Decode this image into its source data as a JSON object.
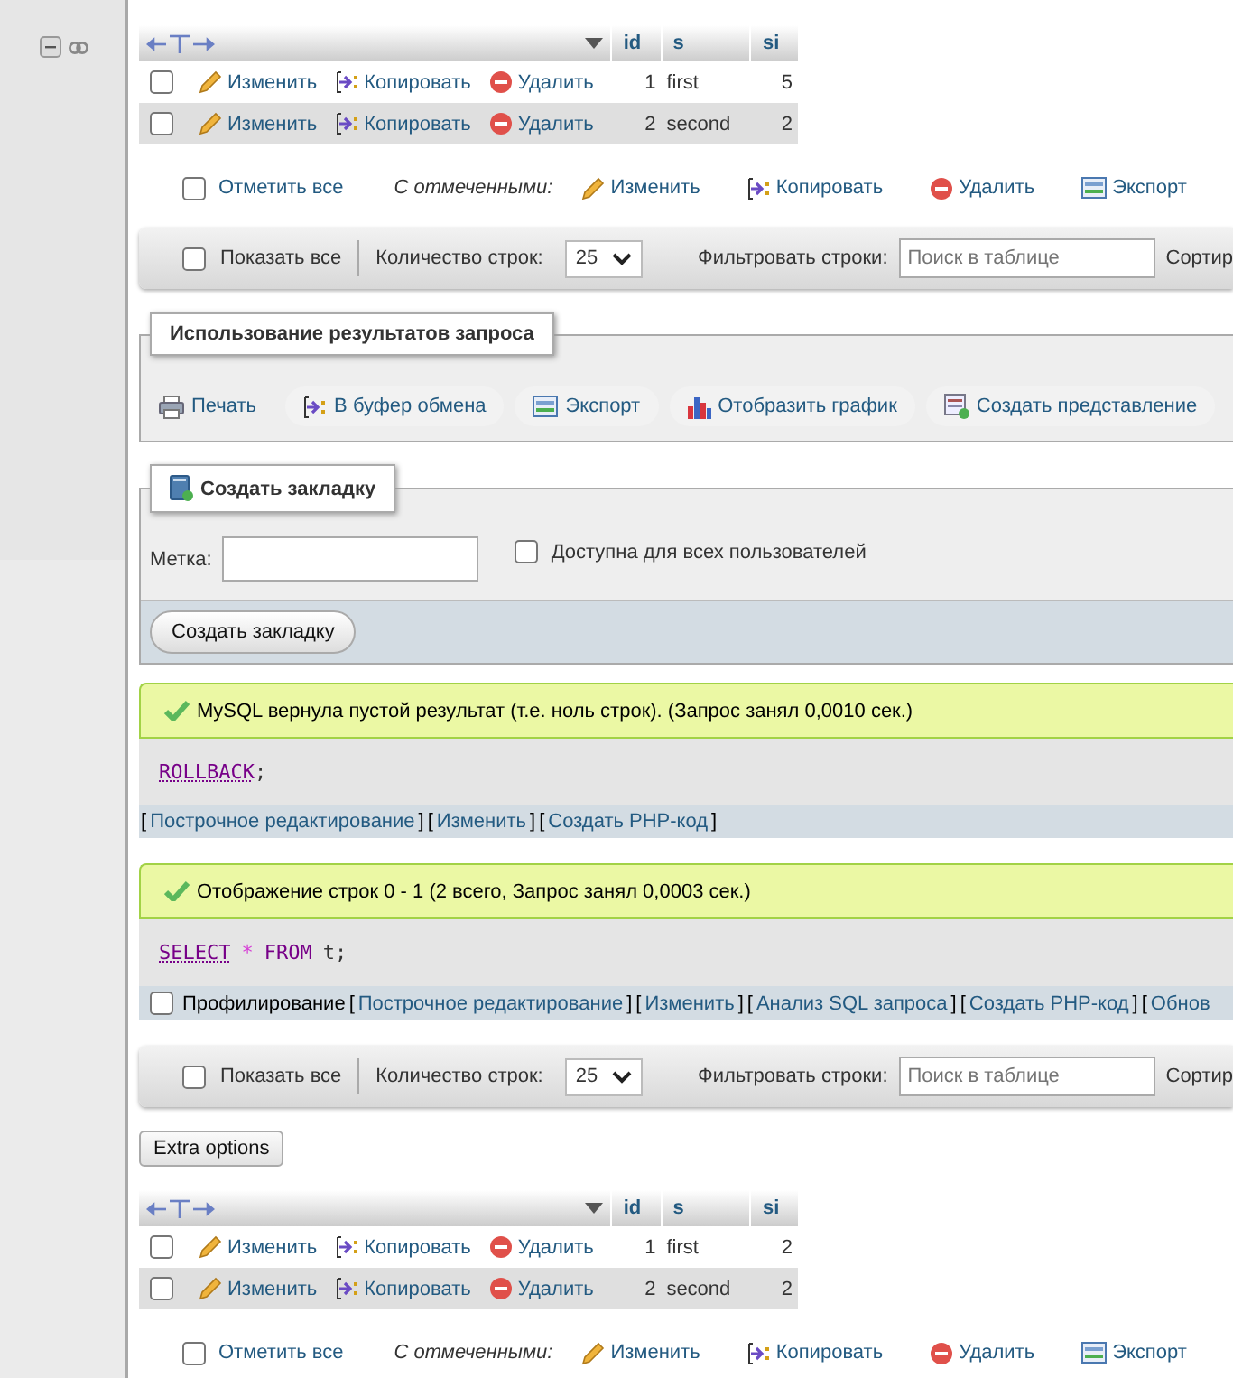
{
  "blocks": [
    {
      "kind": "table",
      "columns": [
        "id",
        "s",
        "si"
      ],
      "rows": [
        {
          "checked": false,
          "actions": [
            "Изменить",
            "Копировать",
            "Удалить"
          ],
          "cells": [
            "1",
            "first",
            "5"
          ]
        },
        {
          "checked": false,
          "actions": [
            "Изменить",
            "Копировать",
            "Удалить"
          ],
          "cells": [
            "2",
            "second",
            "2"
          ]
        }
      ]
    },
    {
      "kind": "bulk",
      "check_all": {
        "label": "Отметить все",
        "checked": false
      },
      "with_selected": "С отмеченными:",
      "actions": [
        "Изменить",
        "Копировать",
        "Удалить",
        "Экспорт"
      ]
    },
    {
      "kind": "nav",
      "show_all": {
        "label": "Показать все",
        "checked": false
      },
      "rows_label": "Количество строк:",
      "rows_value": "25",
      "filter_label": "Фильтровать строки:",
      "filter_placeholder": "Поиск в таблице",
      "sort_label": "Сортир"
    },
    {
      "kind": "operations",
      "legend": "Использование результатов запроса",
      "buttons": [
        "Печать",
        "В буфер обмена",
        "Экспорт",
        "Отобразить график",
        "Создать представление"
      ]
    },
    {
      "kind": "bookmark",
      "legend": "Создать закладку",
      "label_field": "Метка:",
      "public": {
        "label": "Доступна для всех пользователей",
        "checked": false
      },
      "submit": "Создать закладку"
    },
    {
      "kind": "message",
      "text": "MySQL вернула пустой результат (т.е. ноль строк). (Запрос занял 0,0010 сек.)",
      "sql": [
        {
          "kind": "keyword",
          "text": "ROLLBACK"
        },
        {
          "kind": "plain",
          "text": ";"
        }
      ],
      "parts": [
        {
          "kind": "bracket",
          "text": "["
        },
        {
          "kind": "link",
          "text": "Построчное редактирование"
        },
        {
          "kind": "bracket",
          "text": "]"
        },
        {
          "kind": "bracket",
          "text": "["
        },
        {
          "kind": "link",
          "text": "Изменить"
        },
        {
          "kind": "bracket",
          "text": "]"
        },
        {
          "kind": "bracket",
          "text": "["
        },
        {
          "kind": "link",
          "text": "Создать PHP-код"
        },
        {
          "kind": "bracket",
          "text": "]"
        }
      ]
    },
    {
      "kind": "message",
      "text": "Отображение строк 0 - 1 (2 всего, Запрос занял 0,0003 сек.)",
      "sql": [
        {
          "kind": "keyword",
          "text": "SELECT"
        },
        {
          "kind": "operator",
          "text": "*"
        },
        {
          "kind": "keyword",
          "text": "FROM"
        },
        {
          "kind": "plain",
          "text": "t;"
        }
      ],
      "profiling": {
        "label": "Профилирование",
        "checked": false
      },
      "parts": [
        {
          "kind": "bracket",
          "text": "["
        },
        {
          "kind": "link",
          "text": "Построчное редактирование"
        },
        {
          "kind": "bracket",
          "text": "]"
        },
        {
          "kind": "bracket",
          "text": "["
        },
        {
          "kind": "link",
          "text": "Изменить"
        },
        {
          "kind": "bracket",
          "text": "]"
        },
        {
          "kind": "bracket",
          "text": "["
        },
        {
          "kind": "link",
          "text": "Анализ SQL запроса"
        },
        {
          "kind": "bracket",
          "text": "]"
        },
        {
          "kind": "bracket",
          "text": "["
        },
        {
          "kind": "link",
          "text": "Создать PHP-код"
        },
        {
          "kind": "bracket",
          "text": "]"
        },
        {
          "kind": "bracket",
          "text": "["
        },
        {
          "kind": "link",
          "text": "Обнов"
        }
      ]
    },
    {
      "kind": "nav",
      "show_all": {
        "label": "Показать все",
        "checked": false
      },
      "rows_label": "Количество строк:",
      "rows_value": "25",
      "filter_label": "Фильтровать строки:",
      "filter_placeholder": "Поиск в таблице",
      "sort_label": "Сортир"
    },
    {
      "kind": "button",
      "label": "Extra options"
    },
    {
      "kind": "table",
      "columns": [
        "id",
        "s",
        "si"
      ],
      "rows": [
        {
          "checked": false,
          "actions": [
            "Изменить",
            "Копировать",
            "Удалить"
          ],
          "cells": [
            "1",
            "first",
            "2"
          ]
        },
        {
          "checked": false,
          "actions": [
            "Изменить",
            "Копировать",
            "Удалить"
          ],
          "cells": [
            "2",
            "second",
            "2"
          ]
        }
      ]
    },
    {
      "kind": "bulk",
      "check_all": {
        "label": "Отметить все",
        "checked": false
      },
      "with_selected": "С отмеченными:",
      "actions": [
        "Изменить",
        "Копировать",
        "Удалить",
        "Экспорт"
      ]
    }
  ]
}
